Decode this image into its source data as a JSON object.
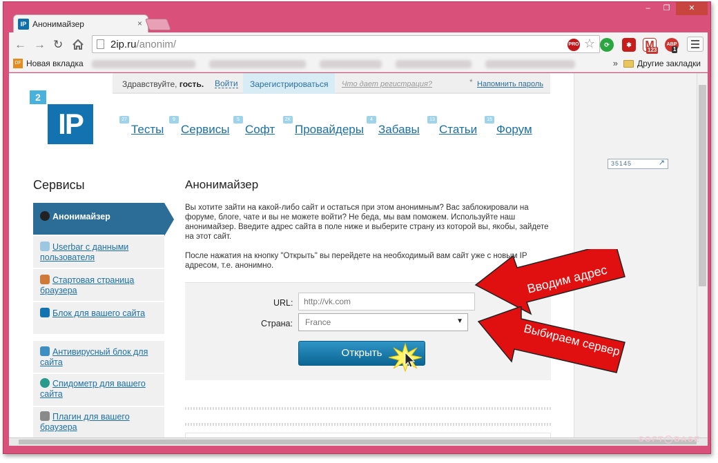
{
  "window": {
    "minimize": "‒",
    "restore": "❐",
    "close": "✕"
  },
  "tab": {
    "favicon": "IP",
    "title": "Анонимайзер",
    "close": "×"
  },
  "toolbar": {
    "url_host": "2ip.ru",
    "url_path": "/anonim/",
    "pro_badge": "PRO",
    "extensions": [
      {
        "icon": "refresh-ext-icon",
        "color": "#2aa640",
        "label": "⟳"
      },
      {
        "icon": "lastpass-icon",
        "color": "#c71c1c",
        "label": "✱"
      },
      {
        "icon": "gmail-icon",
        "color": "#c8332c",
        "label": "M",
        "badge": "123"
      },
      {
        "icon": "adblock-icon",
        "color": "#d2322f",
        "label": "ABP",
        "badge": "1"
      }
    ]
  },
  "bookmarks": {
    "first": "Новая вкладка",
    "first_icon": "DF",
    "more": "»",
    "other": "Другие закладки"
  },
  "loginbar": {
    "greeting": "Здравствуйте,",
    "guest": "гость.",
    "login": "Войти",
    "register": "Зарегистрироваться",
    "why": "Что дает регистрация?",
    "remind": "Напомнить пароль"
  },
  "logo": {
    "small": "2",
    "big": "IP"
  },
  "nav": [
    {
      "badge": "27",
      "label": "Тесты"
    },
    {
      "badge": "9",
      "label": "Сервисы"
    },
    {
      "badge": "5",
      "label": "Софт"
    },
    {
      "badge": "2K",
      "label": "Провайдеры"
    },
    {
      "badge": "4",
      "label": "Забавы"
    },
    {
      "badge": "13",
      "label": "Статьи"
    },
    {
      "badge": "15",
      "label": "Форум"
    }
  ],
  "sidebar": {
    "title": "Сервисы",
    "items": [
      {
        "label": "Анонимайзер",
        "icon": "ninja-icon",
        "active": true
      },
      {
        "label": "Userbar с данными пользователя",
        "icon": "userbar-icon"
      },
      {
        "label": "Стартовая страница браузера",
        "icon": "home-icon"
      },
      {
        "label": "Блок для вашего сайта",
        "icon": "ip-block-icon"
      },
      {
        "label": "Антивирусный блок для сайта",
        "icon": "shield-icon"
      },
      {
        "label": "Спидометр для вашего сайта",
        "icon": "speedometer-icon"
      },
      {
        "label": "Плагин для вашего браузера",
        "icon": "wrench-icon"
      }
    ]
  },
  "main": {
    "title": "Анонимайзер",
    "paragraph1": "Вы хотите зайти на какой-либо сайт и остаться при этом анонимным? Вас заблокировали на форуме, блоге, чате и вы не можете войти? Не беда, мы вам поможем. Используйте наш анонимайзер. Введите адрес сайта в поле ниже и выберите страну из которой вы, якобы, зайдете на этот сайт.",
    "paragraph2": "После нажатия на кнопку \"Открыть\" вы перейдете на необходимый вам сайт уже с новым IP адресом, т.е. анонимно."
  },
  "form": {
    "url_label": "URL:",
    "url_placeholder": "http://vk.com",
    "country_label": "Страна:",
    "country_value": "France",
    "submit": "Открыть"
  },
  "annotations": {
    "arrow1": "Вводим адрес",
    "arrow2": "Выбираем сервер",
    "arrow_color": "#e01010"
  },
  "counter": "35145",
  "watermark": "SOFT◯BASE"
}
